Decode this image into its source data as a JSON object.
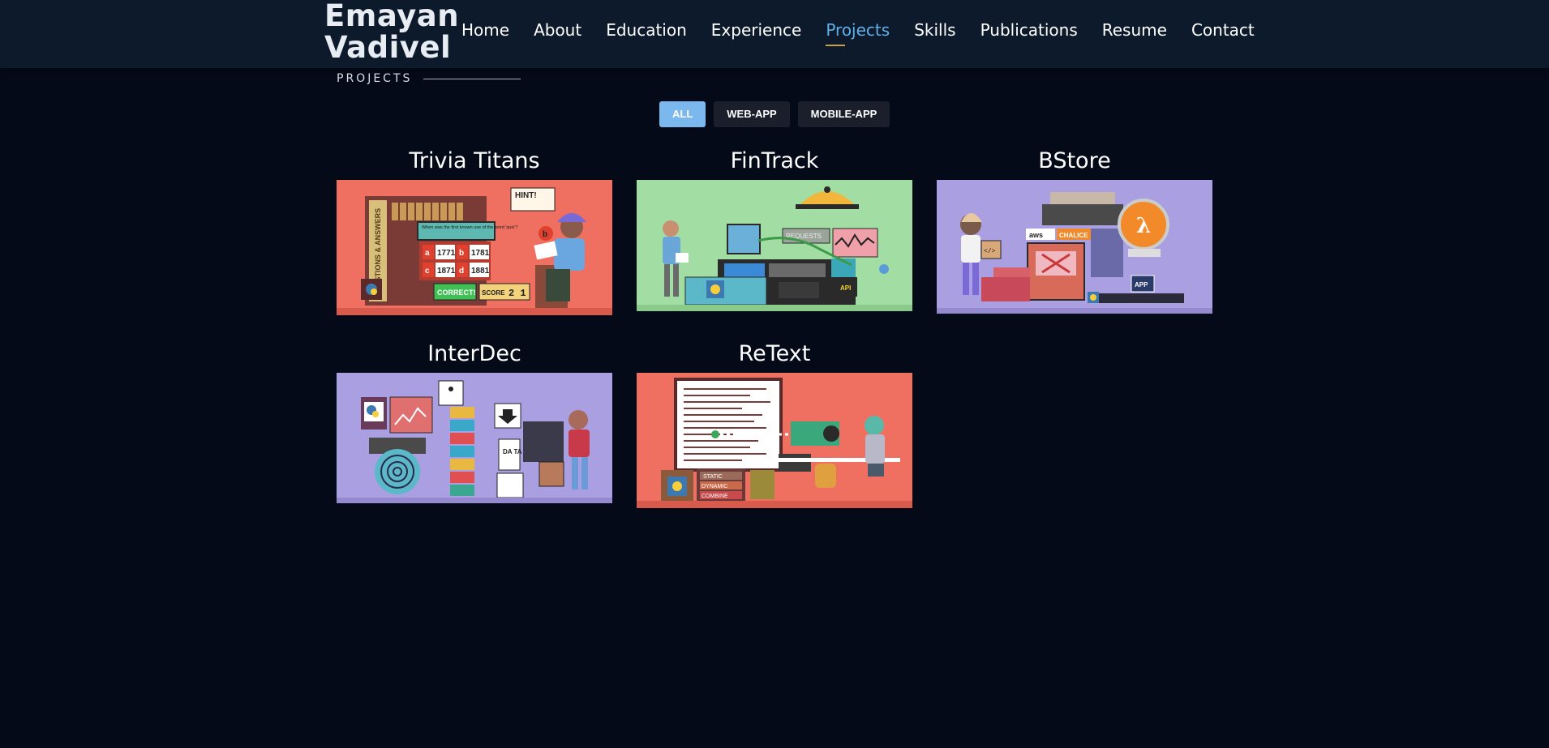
{
  "logo": {
    "line1": "Emayan",
    "line2": "Vadivel"
  },
  "nav": {
    "items": [
      {
        "label": "Home"
      },
      {
        "label": "About"
      },
      {
        "label": "Education"
      },
      {
        "label": "Experience"
      },
      {
        "label": "Projects",
        "active": true
      },
      {
        "label": "Skills"
      },
      {
        "label": "Publications"
      },
      {
        "label": "Resume"
      },
      {
        "label": "Contact"
      }
    ]
  },
  "section": {
    "label": "PROJECTS"
  },
  "filters": [
    {
      "label": "ALL",
      "active": true
    },
    {
      "label": "WEB-APP"
    },
    {
      "label": "MOBILE-APP"
    }
  ],
  "projects": [
    {
      "title": "Trivia Titans",
      "bg": "#ef6f61",
      "icon": "quiz-illustration"
    },
    {
      "title": "FinTrack",
      "bg": "#a2dea3",
      "icon": "finance-illustration"
    },
    {
      "title": "BStore",
      "bg": "#a99fe1",
      "icon": "store-illustration"
    },
    {
      "title": "InterDec",
      "bg": "#a99fe1",
      "icon": "data-illustration"
    },
    {
      "title": "ReText",
      "bg": "#ef6f61",
      "icon": "text-illustration"
    }
  ],
  "illustration_text": {
    "trivia": {
      "hint": "HINT!",
      "question": "When was the first known use of the word 'quiz'?",
      "a": "a",
      "a_val": "1771",
      "b": "b",
      "b_val": "1781",
      "c": "c",
      "c_val": "1871",
      "d": "d",
      "d_val": "1881",
      "shelf": "QUESTIONS & ANSWERS",
      "correct": "CORRECT!",
      "score": "SCORE",
      "score_val": "2 1"
    },
    "fintrack": {
      "requests": "REQUESTS",
      "api": "API"
    },
    "bstore": {
      "aws": "aws",
      "chalice": "CHALICE",
      "lambda": "λ",
      "app": "APP",
      "code": "</>"
    },
    "interdec": {
      "data": "DA TA"
    },
    "retext": {
      "static": "STATIC",
      "dynamic": "DYNAMIC",
      "combine": "COMBINE"
    }
  }
}
